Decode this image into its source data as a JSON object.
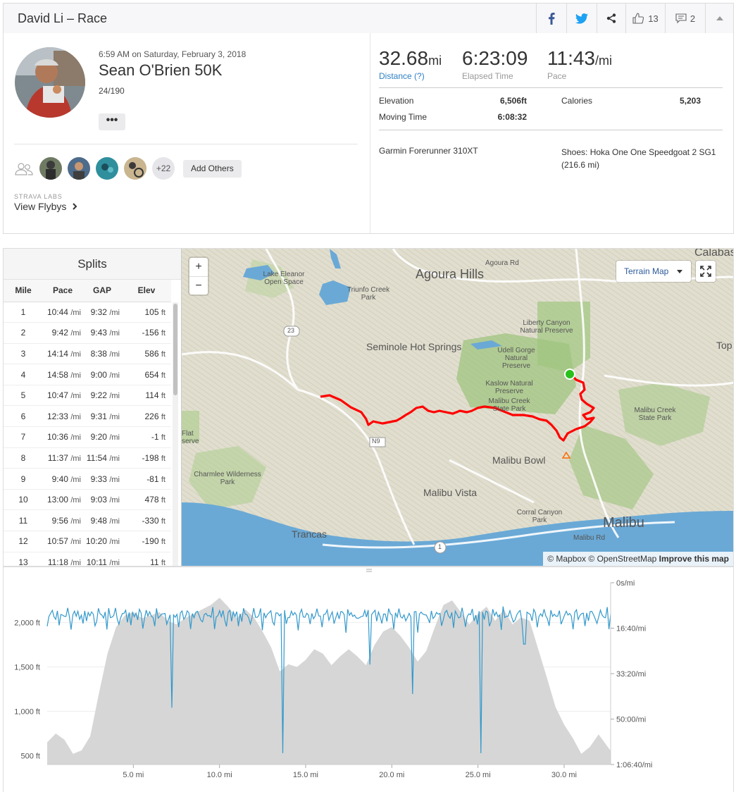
{
  "header": {
    "title": "David Li – Race",
    "kudos_count": "13",
    "comments_count": "2"
  },
  "activity": {
    "date": "6:59 AM on Saturday, February 3, 2018",
    "name": "Sean O'Brien 50K",
    "rank": "24/190",
    "more_label": "•••",
    "others_count": "+22",
    "add_others_label": "Add Others",
    "labs_label": "STRAVA LABS",
    "flybys_label": "View Flybys"
  },
  "stats": {
    "distance_value": "32.68",
    "distance_unit": "mi",
    "distance_label": "Distance (?)",
    "elapsed_value": "6:23:09",
    "elapsed_label": "Elapsed Time",
    "pace_value": "11:43",
    "pace_unit": "/mi",
    "pace_label": "Pace",
    "elevation_label": "Elevation",
    "elevation_value": "6,506ft",
    "calories_label": "Calories",
    "calories_value": "5,203",
    "moving_label": "Moving Time",
    "moving_value": "6:08:32",
    "device": "Garmin Forerunner 310XT",
    "shoes": "Shoes: Hoka One One Speedgoat 2 SG1 (216.6 mi)"
  },
  "splits": {
    "title": "Splits",
    "headers": [
      "Mile",
      "Pace",
      "GAP",
      "Elev"
    ],
    "pace_unit": "/mi",
    "elev_unit": "ft",
    "rows": [
      {
        "mile": "1",
        "pace": "10:44",
        "gap": "9:32",
        "elev": "105"
      },
      {
        "mile": "2",
        "pace": "9:42",
        "gap": "9:43",
        "elev": "-156"
      },
      {
        "mile": "3",
        "pace": "14:14",
        "gap": "8:38",
        "elev": "586"
      },
      {
        "mile": "4",
        "pace": "14:58",
        "gap": "9:00",
        "elev": "654"
      },
      {
        "mile": "5",
        "pace": "10:47",
        "gap": "9:22",
        "elev": "114"
      },
      {
        "mile": "6",
        "pace": "12:33",
        "gap": "9:31",
        "elev": "226"
      },
      {
        "mile": "7",
        "pace": "10:36",
        "gap": "9:20",
        "elev": "-1"
      },
      {
        "mile": "8",
        "pace": "11:37",
        "gap": "11:54",
        "elev": "-198"
      },
      {
        "mile": "9",
        "pace": "9:40",
        "gap": "9:33",
        "elev": "-81"
      },
      {
        "mile": "10",
        "pace": "13:00",
        "gap": "9:03",
        "elev": "478"
      },
      {
        "mile": "11",
        "pace": "9:56",
        "gap": "9:48",
        "elev": "-330"
      },
      {
        "mile": "12",
        "pace": "10:57",
        "gap": "10:20",
        "elev": "-190"
      },
      {
        "mile": "13",
        "pace": "11:18",
        "gap": "10:11",
        "elev": "11"
      }
    ]
  },
  "map": {
    "terrain_label": "Terrain Map",
    "zoom_in": "+",
    "zoom_out": "−",
    "attribution_mapbox": "© Mapbox",
    "attribution_osm": "© OpenStreetMap",
    "attribution_improve": "Improve this map",
    "labels": {
      "agoura_hills": "Agoura Hills",
      "calabasas": "Calabas",
      "lake_eleanor": "Lake Eleanor Open Space",
      "triunfo": "Triunfo Creek Park",
      "agoura_rd": "Agoura Rd",
      "seminole": "Seminole Hot Springs",
      "liberty": "Liberty Canyon Natural Preserve",
      "udell": "Udell Gorge Natural Preserve",
      "kaslow": "Kaslow Natural Preserve",
      "malibu_creek_sp": "Malibu Creek State Park",
      "malibu_creek_sp2": "Malibu Creek State Park",
      "top": "Top",
      "flat": "Flat serve",
      "charmlee": "Charmlee Wilderness Park",
      "malibu_bowl": "Malibu Bowl",
      "malibu_vista": "Malibu Vista",
      "corral": "Corral Canyon Park",
      "trancas": "Trancas",
      "malibu": "Malibu",
      "malibu_rd": "Malibu Rd",
      "n9": "N9",
      "hw23": "23",
      "hw1": "1"
    }
  },
  "chart_data": {
    "type": "area",
    "x_ticks": [
      "5.0 mi",
      "10.0 mi",
      "15.0 mi",
      "20.0 mi",
      "25.0 mi",
      "30.0 mi"
    ],
    "y_left_ticks": [
      "2,000 ft",
      "1,500 ft",
      "1,000 ft",
      "500 ft"
    ],
    "y_right_ticks": [
      "0s/mi",
      "16:40/mi",
      "33:20/mi",
      "50:00/mi",
      "1:06:40/mi"
    ],
    "xlim": [
      0,
      32.7
    ],
    "ylim_left": [
      400,
      2450
    ],
    "ylim_right_sec": [
      0,
      4000
    ],
    "colors": {
      "elevation_fill": "#d6d6d6",
      "pace_line": "#3399cc"
    },
    "elevation": {
      "x": [
        0,
        0.5,
        1.0,
        1.5,
        2.0,
        2.5,
        3.0,
        3.5,
        4.0,
        4.5,
        5.0,
        5.5,
        6.0,
        6.5,
        7.0,
        7.5,
        8.0,
        8.5,
        9.0,
        9.5,
        10.0,
        10.5,
        11.0,
        11.5,
        12.0,
        12.5,
        13.0,
        13.5,
        14.0,
        14.5,
        15.0,
        15.5,
        16.0,
        16.5,
        17.0,
        17.5,
        18.0,
        18.5,
        19.0,
        19.5,
        20.0,
        20.5,
        21.0,
        21.5,
        22.0,
        22.5,
        23.0,
        23.5,
        24.0,
        24.5,
        25.0,
        25.5,
        26.0,
        26.5,
        27.0,
        27.5,
        28.0,
        28.5,
        29.0,
        29.5,
        30.0,
        30.5,
        31.0,
        31.5,
        32.0,
        32.68
      ],
      "ft": [
        650,
        750,
        680,
        520,
        560,
        720,
        1200,
        1650,
        1950,
        2080,
        2120,
        2050,
        2080,
        2120,
        2020,
        1980,
        2050,
        2100,
        2150,
        2200,
        2280,
        2180,
        2050,
        2150,
        2060,
        1900,
        1720,
        1450,
        1530,
        1500,
        1580,
        1700,
        1650,
        1520,
        1620,
        1700,
        1620,
        1520,
        1750,
        1900,
        1950,
        1850,
        1720,
        1560,
        1680,
        1950,
        2200,
        2250,
        2120,
        1980,
        2100,
        2180,
        2020,
        2150,
        1980,
        2060,
        2020,
        1700,
        1380,
        1050,
        850,
        700,
        520,
        600,
        740,
        560
      ]
    },
    "pace": {
      "note": "seconds per mile",
      "spikes": [
        {
          "x": 7.2,
          "sec": 2750
        },
        {
          "x": 13.7,
          "sec": 3750
        },
        {
          "x": 18.7,
          "sec": 1800
        },
        {
          "x": 21.2,
          "sec": 2450
        },
        {
          "x": 25.2,
          "sec": 3750
        },
        {
          "x": 27.7,
          "sec": 1350
        }
      ],
      "base_sec": 700
    }
  }
}
